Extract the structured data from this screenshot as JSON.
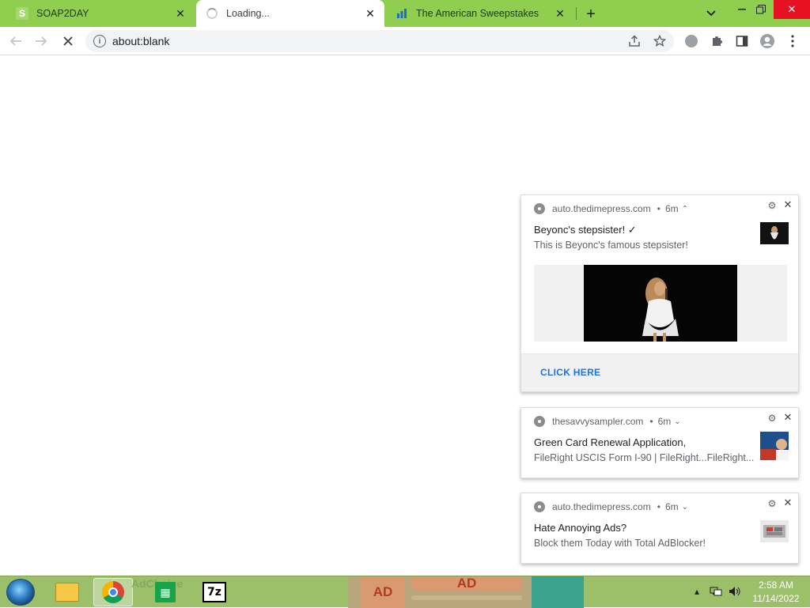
{
  "tabs": [
    {
      "title": "SOAP2DAY",
      "favicon": "S",
      "active": false
    },
    {
      "title": "Loading...",
      "favicon": "loading-spinner",
      "active": true
    },
    {
      "title": "The American Sweepstakes",
      "favicon": "sweepstakes-icon",
      "active": false
    }
  ],
  "toolbar": {
    "url": "about:blank"
  },
  "notifications": [
    {
      "source": "auto.thedimepress.com",
      "age": "6m",
      "title": "Beyonc's stepsister! ✓",
      "message": "This is Beyonc's famous stepsister!",
      "action": "CLICK HERE"
    },
    {
      "source": "thesavvysampler.com",
      "age": "6m",
      "title": "Green Card Renewal Application,",
      "message": "FileRight USCIS Form I-90 | FileRight...FileRight..."
    },
    {
      "source": "auto.thedimepress.com",
      "age": "6m",
      "title": "Hate Annoying Ads?",
      "message": "Block them Today with Total AdBlocker!"
    }
  ],
  "taskbar": {
    "apps": [
      "file-explorer",
      "google-chrome",
      "windows-store",
      "7-zip"
    ],
    "ad_labels": [
      "AD",
      "AD"
    ],
    "ghost_text": "AdChoice",
    "clock_time": "2:58 AM",
    "clock_date": "11/14/2022"
  },
  "colors": {
    "tabstrip": "#8fce4f",
    "taskbar": "#9bc069",
    "link": "#1a73e8",
    "close_button": "#e81123"
  }
}
